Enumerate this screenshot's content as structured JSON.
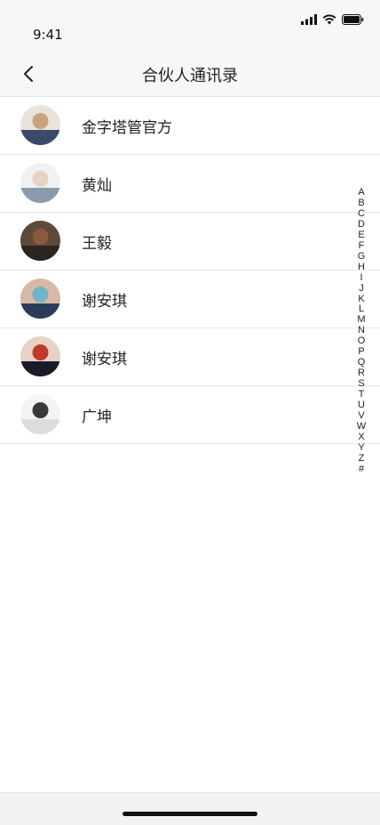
{
  "status_bar": {
    "time": "9:41"
  },
  "nav": {
    "title": "合伙人通讯录",
    "back_icon": "chevron-left-icon"
  },
  "contacts": [
    {
      "name": "金字塔管官方",
      "avatar_colors": [
        "#3b4a6b",
        "#c9a27e",
        "#e8e4dc"
      ]
    },
    {
      "name": "黄灿",
      "avatar_colors": [
        "#8a9aa8",
        "#e6d3c2",
        "#f1f1f1"
      ]
    },
    {
      "name": "王毅",
      "avatar_colors": [
        "#2b2420",
        "#8a5a3c",
        "#5c4a3a"
      ]
    },
    {
      "name": "谢安琪",
      "avatar_colors": [
        "#2d3b5a",
        "#6fb4c8",
        "#d9b8a8"
      ]
    },
    {
      "name": "谢安琪",
      "avatar_colors": [
        "#1a1a2a",
        "#c0392b",
        "#e8d2c6"
      ]
    },
    {
      "name": "广坤",
      "avatar_colors": [
        "#dcdcdc",
        "#3a3a3a",
        "#f4f4f4"
      ]
    }
  ],
  "index_letters": [
    "A",
    "B",
    "C",
    "D",
    "E",
    "F",
    "G",
    "H",
    "I",
    "J",
    "K",
    "L",
    "M",
    "N",
    "O",
    "P",
    "Q",
    "R",
    "S",
    "T",
    "U",
    "V",
    "W",
    "X",
    "Y",
    "Z",
    "#"
  ]
}
